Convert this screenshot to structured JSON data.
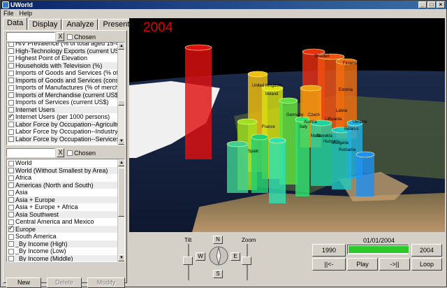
{
  "window": {
    "title": "UWorld"
  },
  "menu": [
    "File",
    "Help"
  ],
  "tabs": [
    "Data",
    "Display",
    "Analyze",
    "Present"
  ],
  "data_panel": {
    "search_clear": "X",
    "chosen_label": "Chosen",
    "indicators": [
      {
        "label": "HIV Prevalence (% of total aged 15-49)",
        "checked": false
      },
      {
        "label": "High-Technology Exports (current US$)",
        "checked": false
      },
      {
        "label": "Highest Point of Elevation",
        "checked": false
      },
      {
        "label": "Households with Television (%)",
        "checked": false
      },
      {
        "label": "Imports of Goods and Services (% of GDP)",
        "checked": false
      },
      {
        "label": "Imports of Goods and Services (constant",
        "checked": false
      },
      {
        "label": "Imports of Manufactures (% of merchandise",
        "checked": false
      },
      {
        "label": "Imports of Merchandise (current US$)",
        "checked": false
      },
      {
        "label": "Imports of Services (current US$)",
        "checked": false
      },
      {
        "label": "Internet Users",
        "checked": false
      },
      {
        "label": "Internet Users (per 1000 persons)",
        "checked": true
      },
      {
        "label": "Labor Force by Occupation--Agriculture",
        "checked": false
      },
      {
        "label": "Labor Force by Occupation--Industry",
        "checked": false
      },
      {
        "label": "Labor Force by Occupation--Services",
        "checked": false
      }
    ],
    "regions": [
      {
        "label": "World",
        "checked": false
      },
      {
        "label": "World (Without Smallest by Area)",
        "checked": false
      },
      {
        "label": "Africa",
        "checked": false
      },
      {
        "label": "Americas (North and South)",
        "checked": false
      },
      {
        "label": "Asia",
        "checked": false
      },
      {
        "label": "Asia + Europe",
        "checked": false
      },
      {
        "label": "Asia + Europe + Africa",
        "checked": false
      },
      {
        "label": "Asia Southwest",
        "checked": false
      },
      {
        "label": "Central America and Mexico",
        "checked": false
      },
      {
        "label": "Europe",
        "checked": true
      },
      {
        "label": "South America",
        "checked": false
      },
      {
        "label": "_By Income (High)",
        "checked": false
      },
      {
        "label": "_By Income (Low)",
        "checked": false
      },
      {
        "label": "_By Income (Middle)",
        "checked": false
      }
    ],
    "buttons": {
      "new": "New",
      "delete": "Delete",
      "modify": "Modify"
    }
  },
  "view": {
    "year": "2004",
    "countries": [
      "Sweden",
      "Finland",
      "United Kingdom",
      "Estonia",
      "Germany",
      "France",
      "Italy",
      "Spain",
      "Latvia",
      "Belarus",
      "Lithuania",
      "Romania",
      "Hungary",
      "Slovakia",
      "Ireland",
      "Austria",
      "Czech",
      "Malta",
      "Bulgaria",
      "Ukraine"
    ]
  },
  "controls": {
    "tilt_label": "Tilt",
    "zoom_label": "Zoom",
    "north": "N",
    "south": "S",
    "east": "E",
    "west": "W",
    "date": "01/01/2004",
    "start_year": "1990",
    "end_year": "2004",
    "progress": 1.0,
    "rewind": "||<-",
    "play": "Play",
    "forward": "->||",
    "loop": "Loop"
  }
}
